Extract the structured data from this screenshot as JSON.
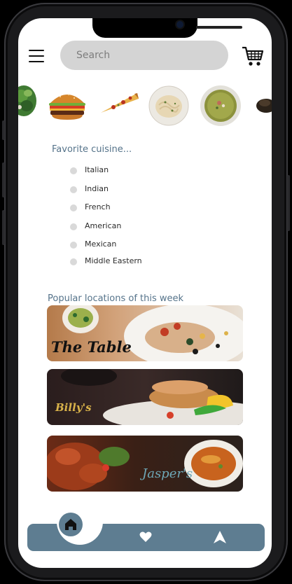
{
  "header": {
    "search_placeholder": "Search",
    "menu_icon": "hamburger-menu-icon",
    "cart_icon": "shopping-cart-icon"
  },
  "food_strip": [
    {
      "name": "salad"
    },
    {
      "name": "burger"
    },
    {
      "name": "pizza-slice"
    },
    {
      "name": "pasta-plate"
    },
    {
      "name": "soup-bowl"
    },
    {
      "name": "chocolate-dessert"
    }
  ],
  "cuisine": {
    "title": "Favorite cuisine...",
    "items": [
      {
        "label": "Italian"
      },
      {
        "label": "Indian"
      },
      {
        "label": "French"
      },
      {
        "label": "American"
      },
      {
        "label": "Mexican"
      },
      {
        "label": "Middle Eastern"
      }
    ]
  },
  "popular": {
    "title": "Popular locations of this week",
    "locations": [
      {
        "name": "The Table"
      },
      {
        "name": "Billy's"
      },
      {
        "name": "Jasper's"
      }
    ]
  },
  "bottom_nav": {
    "items": [
      {
        "icon": "home-icon"
      },
      {
        "icon": "heart-icon"
      },
      {
        "icon": "navigation-arrow-icon"
      }
    ]
  },
  "colors": {
    "accent": "#5e7d91",
    "title_text": "#55738a",
    "search_bg": "#d4d4d4",
    "dot": "#d9d9d9"
  }
}
